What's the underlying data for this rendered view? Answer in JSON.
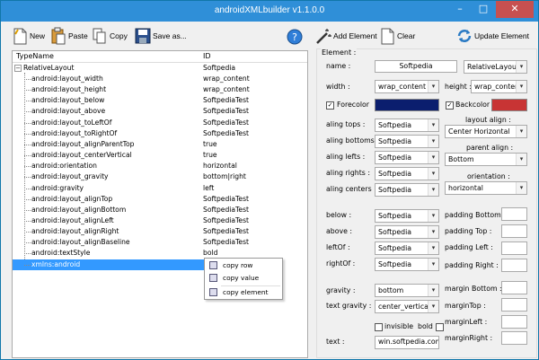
{
  "window": {
    "title": "androidXMLbuilder v1.1.0.0"
  },
  "titlebar_buttons": {
    "minimize": "–",
    "maximize": "□",
    "close": "✕"
  },
  "toolbar": {
    "new": "New",
    "paste": "Paste",
    "copy": "Copy",
    "save_as": "Save as...",
    "add_element": "Add Element",
    "clear": "Clear",
    "update_element": "Update Element"
  },
  "tree": {
    "col_type": "TypeName",
    "col_id": "ID",
    "root": {
      "name": "RelativeLayout",
      "value": "Softpedia"
    },
    "items": [
      {
        "name": "android:layout_width",
        "value": "wrap_content"
      },
      {
        "name": "android:layout_height",
        "value": "wrap_content"
      },
      {
        "name": "android:layout_below",
        "value": "SoftpediaTest"
      },
      {
        "name": "android:layout_above",
        "value": "SoftpediaTest"
      },
      {
        "name": "android:layout_toLeftOf",
        "value": "SoftpediaTest"
      },
      {
        "name": "android:layout_toRightOf",
        "value": "SoftpediaTest"
      },
      {
        "name": "android:layout_alignParentTop",
        "value": "true"
      },
      {
        "name": "android:layout_centerVertical",
        "value": "true"
      },
      {
        "name": "android:orientation",
        "value": "horizontal"
      },
      {
        "name": "android:layout_gravity",
        "value": "bottom|right"
      },
      {
        "name": "android:gravity",
        "value": "left"
      },
      {
        "name": "android:layout_alignTop",
        "value": "SoftpediaTest"
      },
      {
        "name": "android:layout_alignBottom",
        "value": "SoftpediaTest"
      },
      {
        "name": "android:layout_alignLeft",
        "value": "SoftpediaTest"
      },
      {
        "name": "android:layout_alignRight",
        "value": "SoftpediaTest"
      },
      {
        "name": "android:layout_alignBaseline",
        "value": "SoftpediaTest"
      },
      {
        "name": "android:textStyle",
        "value": "bold"
      },
      {
        "name": "xmlns:android",
        "value": ""
      }
    ]
  },
  "context_menu": {
    "copy_row": "copy row",
    "copy_value": "copy value",
    "copy_element": "copy element"
  },
  "element": {
    "group_title": "Element :",
    "name_label": "name :",
    "name_value": "Softpedia",
    "type_value": "RelativeLayout",
    "width_label": "width :",
    "width_value": "wrap_content",
    "height_label": "height :",
    "height_value": "wrap_content",
    "forecolor_label": "Forecolor",
    "backcolor_label": "Backcolor",
    "forecolor": "#0b1e6e",
    "backcolor": "#c83434",
    "aling_tops_label": "aling tops :",
    "aling_tops_value": "Softpedia",
    "aling_bottoms_label": "aling bottoms :",
    "aling_bottoms_value": "Softpedia",
    "aling_lefts_label": "aling lefts :",
    "aling_lefts_value": "Softpedia",
    "aling_rights_label": "aling rights :",
    "aling_rights_value": "Softpedia",
    "aling_centers_label": "aling centers :",
    "aling_centers_value": "Softpedia",
    "layout_align_label": "layout align :",
    "layout_align_value": "Center Horizontal",
    "parent_align_label": "parent align :",
    "parent_align_value": "Bottom",
    "orientation_label": "orientation :",
    "orientation_value": "horizontal",
    "below_label": "below :",
    "below_value": "Softpedia",
    "above_label": "above :",
    "above_value": "Softpedia",
    "leftof_label": "leftOf :",
    "leftof_value": "Softpedia",
    "rightof_label": "rightOf :",
    "rightof_value": "Softpedia",
    "padding_bottom_label": "padding Bottom :",
    "padding_top_label": "padding Top :",
    "padding_left_label": "padding Left :",
    "padding_right_label": "padding Right :",
    "gravity_label": "gravity :",
    "gravity_value": "bottom",
    "text_gravity_label": "text gravity :",
    "text_gravity_value": "center_vertical",
    "margin_bottom_label": "margin Bottom :",
    "margin_top_label": "marginTop :",
    "margin_left_label": "marginLeft :",
    "margin_right_label": "marginRight :",
    "invisible_label": "invisible",
    "bold_label": "bold",
    "text_label": "text :",
    "text_value": "win.softpedia.com",
    "check_mark": "✓"
  }
}
